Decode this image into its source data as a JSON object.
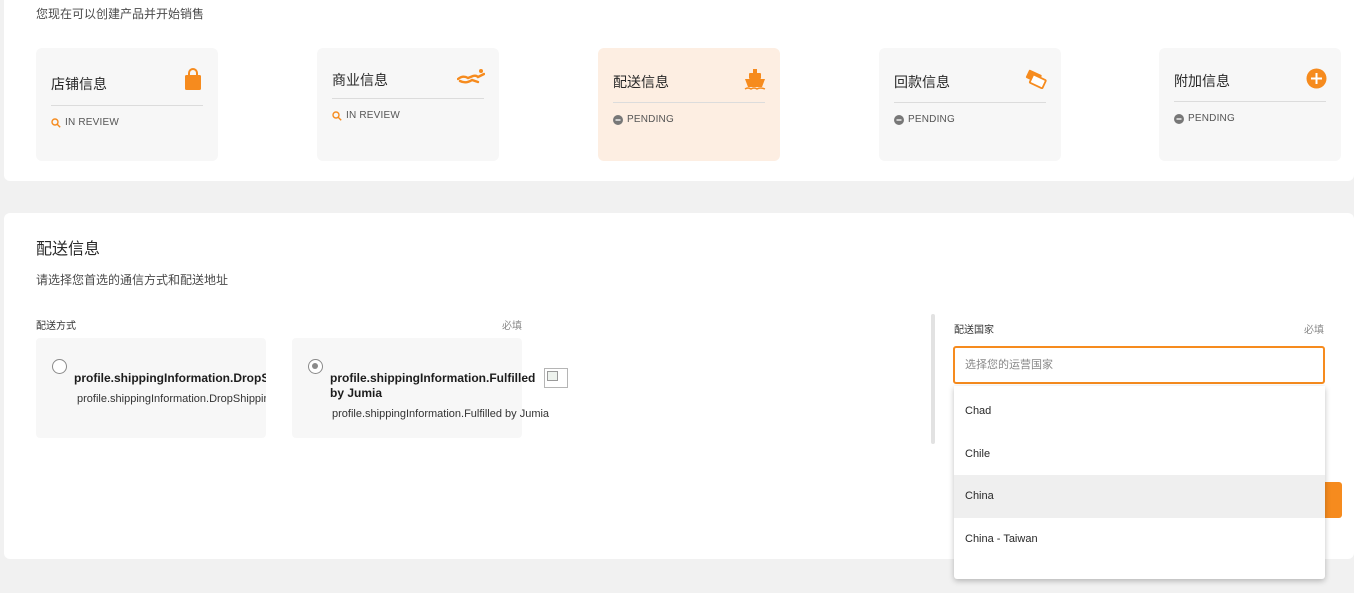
{
  "header": {
    "subtitle": "您现在可以创建产品并开始销售"
  },
  "steps": [
    {
      "title": "店铺信息",
      "status": "IN REVIEW",
      "status_icon": "search-icon",
      "icon": "shopping-bag-icon"
    },
    {
      "title": "商业信息",
      "status": "IN REVIEW",
      "status_icon": "search-icon",
      "icon": "handshake-icon"
    },
    {
      "title": "配送信息",
      "status": "PENDING",
      "status_icon": "pending-icon",
      "icon": "ship-icon"
    },
    {
      "title": "回款信息",
      "status": "PENDING",
      "status_icon": "pending-icon",
      "icon": "money-icon"
    },
    {
      "title": "附加信息",
      "status": "PENDING",
      "status_icon": "pending-icon",
      "icon": "plus-circle-icon"
    }
  ],
  "section": {
    "title": "配送信息",
    "description": "请选择您首选的通信方式和配送地址"
  },
  "shipping_method": {
    "label": "配送方式",
    "required": "必填",
    "options": [
      {
        "title": "profile.shippingInformation.DropShipping",
        "subtitle": "profile.shippingInformation.DropShipping",
        "checked": false
      },
      {
        "title_line1": "profile.shippingInformation.Fulfilled",
        "title_line2": "by Jumia",
        "subtitle": "profile.shippingInformation.Fulfilled by Jumia",
        "checked": true
      }
    ]
  },
  "shipping_country": {
    "label": "配送国家",
    "required": "必填",
    "placeholder": "选择您的运营国家",
    "options": [
      "Chad",
      "Chile",
      "China",
      "China - Taiwan"
    ],
    "highlighted": "China"
  },
  "colors": {
    "accent": "#f68b1e",
    "active_card": "#fdeee2",
    "card": "#f7f7f7"
  }
}
